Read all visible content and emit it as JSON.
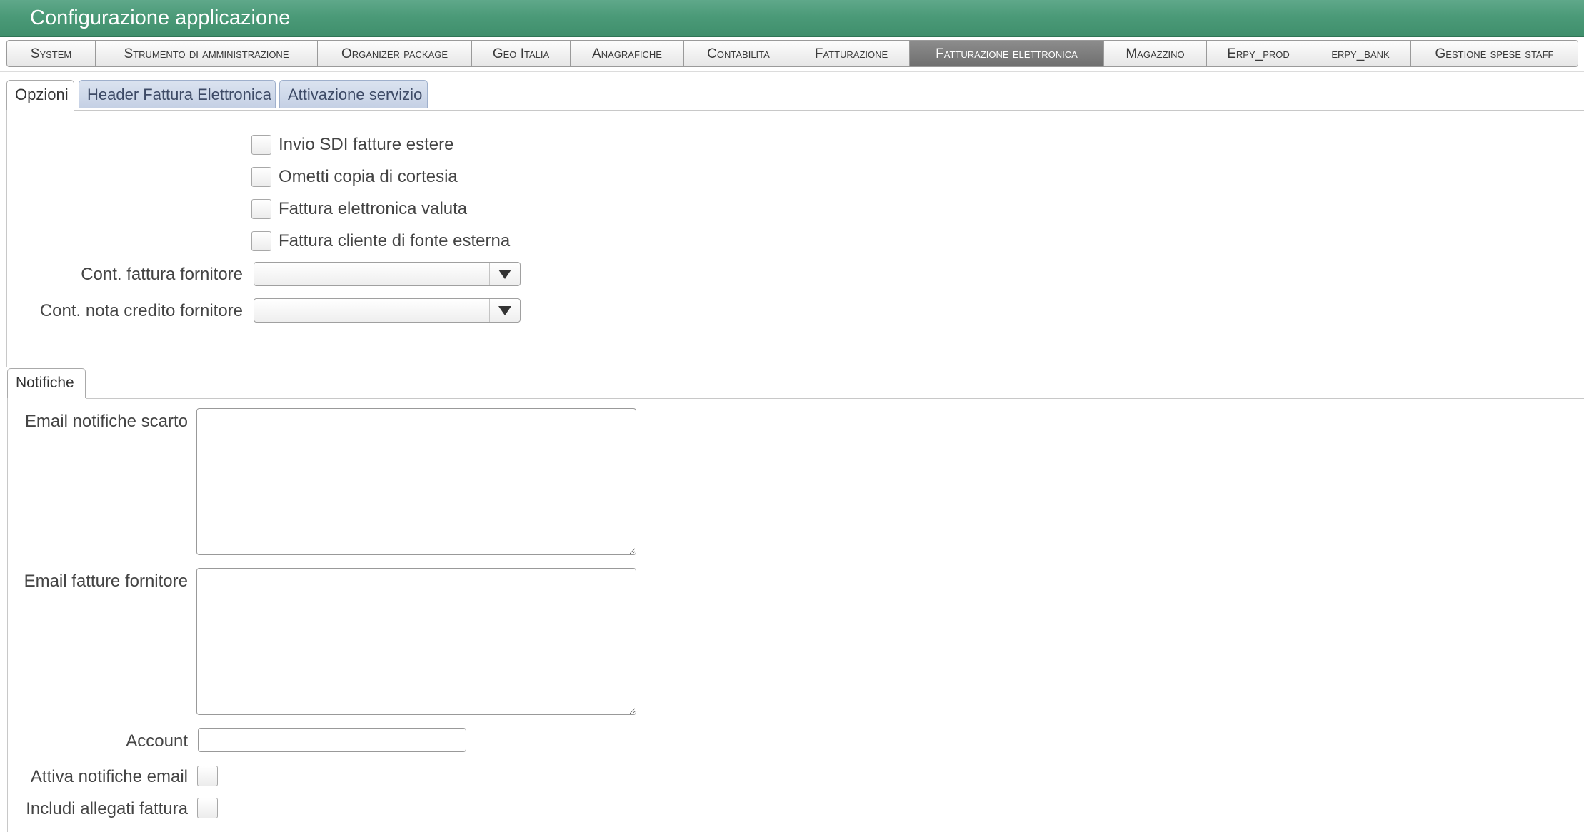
{
  "window": {
    "title": "Configurazione applicazione"
  },
  "menu": {
    "items": [
      {
        "label": "System",
        "active": false
      },
      {
        "label": "Strumento di amministrazione",
        "active": false
      },
      {
        "label": "Organizer package",
        "active": false
      },
      {
        "label": "Geo Italia",
        "active": false
      },
      {
        "label": "Anagrafiche",
        "active": false
      },
      {
        "label": "Contabilita",
        "active": false
      },
      {
        "label": "Fatturazione",
        "active": false
      },
      {
        "label": "Fatturazione elettronica",
        "active": true
      },
      {
        "label": "Magazzino",
        "active": false
      },
      {
        "label": "Erpy_prod",
        "active": false
      },
      {
        "label": "erpy_bank",
        "active": false
      },
      {
        "label": "Gestione spese staff",
        "active": false
      }
    ]
  },
  "tabs": {
    "items": [
      {
        "label": "Opzioni",
        "active": true
      },
      {
        "label": "Header Fattura Elettronica",
        "active": false
      },
      {
        "label": "Attivazione servizio",
        "active": false
      }
    ]
  },
  "options": {
    "checkboxes": [
      {
        "label": "Invio SDI fatture estere",
        "checked": false
      },
      {
        "label": "Ometti copia di cortesia",
        "checked": false
      },
      {
        "label": "Fattura elettronica valuta",
        "checked": false
      },
      {
        "label": "Fattura cliente di fonte esterna",
        "checked": false
      }
    ],
    "cont_fattura_fornitore": {
      "label": "Cont. fattura fornitore",
      "value": ""
    },
    "cont_nota_credito_fornitore": {
      "label": "Cont. nota credito fornitore",
      "value": ""
    }
  },
  "notifiche": {
    "tab_label": "Notifiche",
    "email_scarto": {
      "label": "Email notifiche scarto",
      "value": ""
    },
    "email_fatture_fornitore": {
      "label": "Email fatture fornitore",
      "value": ""
    },
    "account": {
      "label": "Account",
      "value": ""
    },
    "attiva_notifiche_email": {
      "label": "Attiva notifiche email",
      "checked": false
    },
    "includi_allegati_fattura": {
      "label": "Includi allegati fattura",
      "checked": false
    }
  },
  "colors": {
    "titlebar": "#4b9a78",
    "active_menu": "#7d7d7d",
    "inactive_tab": "#c9d4e6"
  }
}
